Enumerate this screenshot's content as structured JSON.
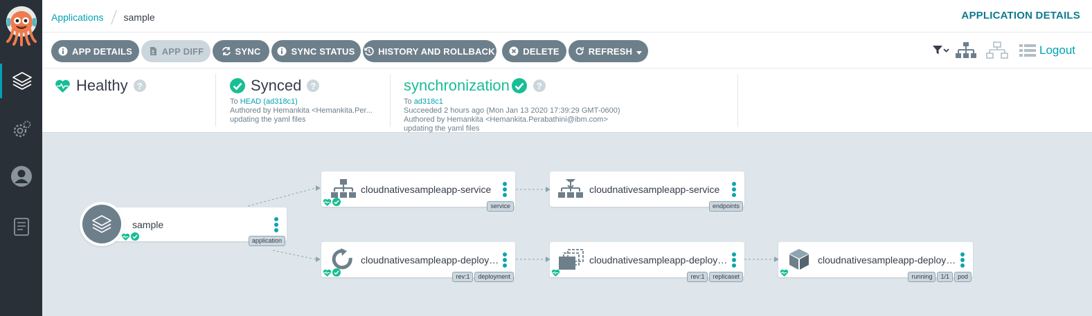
{
  "colors": {
    "accent": "#00a2b3",
    "healthy": "#18be94",
    "sidebar": "#2a3038",
    "button": "#6d7f8b"
  },
  "sidebar": {
    "logo": "argo-logo",
    "items": [
      {
        "icon": "layers-icon",
        "active": true
      },
      {
        "icon": "gear-icon",
        "active": false
      },
      {
        "icon": "user-icon",
        "active": false
      },
      {
        "icon": "docs-icon",
        "active": false
      }
    ]
  },
  "header": {
    "breadcrumb": {
      "parent": "Applications",
      "current": "sample"
    },
    "title": "APPLICATION DETAILS"
  },
  "toolbar": {
    "app_details": "APP DETAILS",
    "app_diff": "APP DIFF",
    "sync": "SYNC",
    "sync_status": "SYNC STATUS",
    "history": "HISTORY AND ROLLBACK",
    "delete": "DELETE",
    "refresh": "REFRESH",
    "logout": "Logout"
  },
  "status": {
    "health": {
      "label": "Healthy",
      "help": "?"
    },
    "sync": {
      "label": "Synced",
      "help": "?",
      "to_prefix": "To",
      "to_value": "HEAD (ad318c1)",
      "author": "Authored by Hemankita <Hemankita.Per...",
      "message": "updating the yaml files"
    },
    "operation": {
      "label": "synchronization",
      "help": "?",
      "to_prefix": "To",
      "to_value": "ad318c1",
      "result": "Succeeded 2 hours ago (Mon Jan 13 2020 17:39:29 GMT-0600)",
      "author": "Authored by Hemankita <Hemankita.Perabathini@ibm.com>",
      "message": "updating the yaml files"
    }
  },
  "graph": {
    "nodes": {
      "app": {
        "name": "sample",
        "tags": [
          "application"
        ]
      },
      "svc": {
        "name": "cloudnativesampleapp-service",
        "tags": [
          "service"
        ]
      },
      "ep": {
        "name": "cloudnativesampleapp-service",
        "tags": [
          "endpoints"
        ]
      },
      "dep": {
        "name": "cloudnativesampleapp-deployment",
        "tags": [
          "rev:1",
          "deployment"
        ]
      },
      "rs": {
        "name": "cloudnativesampleapp-deploymen...",
        "tags": [
          "rev:1",
          "replicaset"
        ]
      },
      "pod": {
        "name": "cloudnativesampleapp-deploymen...",
        "tags": [
          "running",
          "1/1",
          "pod"
        ]
      }
    }
  }
}
